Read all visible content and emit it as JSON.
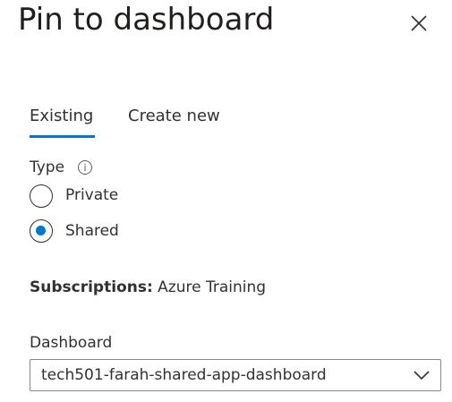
{
  "title": "Pin to dashboard",
  "tabs": [
    {
      "label": "Existing",
      "selected": true
    },
    {
      "label": "Create new",
      "selected": false
    }
  ],
  "type": {
    "label": "Type",
    "info": "i",
    "options": [
      {
        "label": "Private",
        "selected": false
      },
      {
        "label": "Shared",
        "selected": true
      }
    ]
  },
  "subscriptions": {
    "label": "Subscriptions:",
    "value": "Azure Training"
  },
  "dashboard": {
    "label": "Dashboard",
    "value": "tech501-farah-shared-app-dashboard"
  },
  "accent": "#0078d4"
}
